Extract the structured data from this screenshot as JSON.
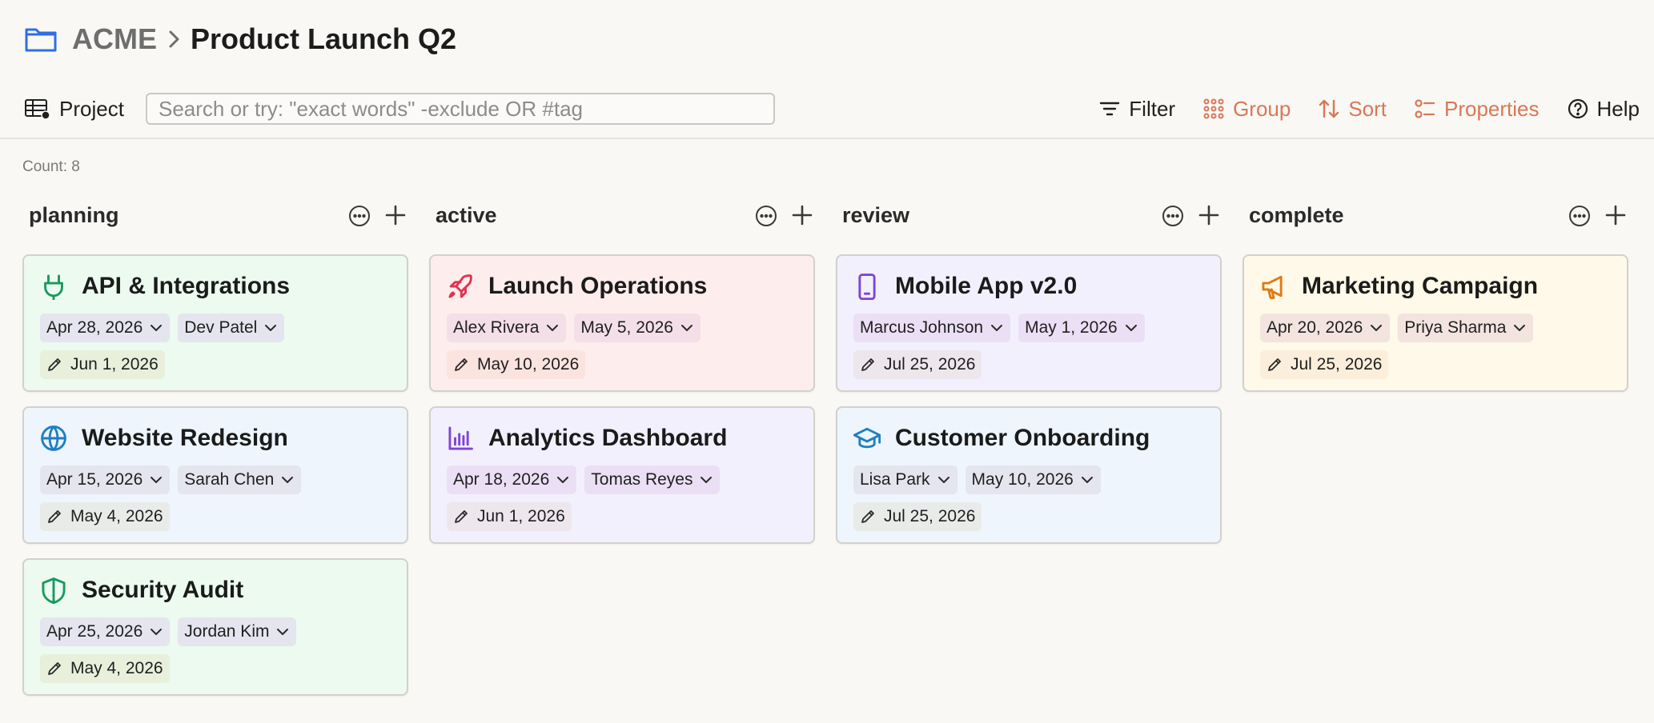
{
  "breadcrumb": {
    "root": "ACME",
    "current": "Product Launch Q2"
  },
  "toolbar": {
    "view_label": "Project",
    "search_placeholder": "Search or try: \"exact words\" -exclude OR #tag",
    "filter_label": "Filter",
    "group_label": "Group",
    "sort_label": "Sort",
    "properties_label": "Properties",
    "help_label": "Help"
  },
  "count_label": "Count: 8",
  "colors": {
    "accent": "#d97757",
    "folder_blue": "#2f6fe4"
  },
  "columns": [
    {
      "title": "planning",
      "cards": [
        {
          "title": "API & Integrations",
          "icon": "plug-icon",
          "icon_color": "#179a5b",
          "theme": "green",
          "chip1": "Apr 28, 2026",
          "chip2": "Dev Patel",
          "updated": "Jun 1, 2026"
        },
        {
          "title": "Website Redesign",
          "icon": "globe-icon",
          "icon_color": "#1f7fc2",
          "theme": "blue",
          "chip1": "Apr 15, 2026",
          "chip2": "Sarah Chen",
          "updated": "May 4, 2026"
        },
        {
          "title": "Security Audit",
          "icon": "shield-icon",
          "icon_color": "#179a5b",
          "theme": "green",
          "chip1": "Apr 25, 2026",
          "chip2": "Jordan Kim",
          "updated": "May 4, 2026"
        }
      ]
    },
    {
      "title": "active",
      "cards": [
        {
          "title": "Launch Operations",
          "icon": "rocket-icon",
          "icon_color": "#e0334f",
          "theme": "pink",
          "chip1": "Alex Rivera",
          "chip2": "May 5, 2026",
          "updated": "May 10, 2026"
        },
        {
          "title": "Analytics Dashboard",
          "icon": "bar-chart-icon",
          "icon_color": "#7c44d8",
          "theme": "lavender",
          "chip1": "Apr 18, 2026",
          "chip2": "Tomas Reyes",
          "updated": "Jun 1, 2026"
        }
      ]
    },
    {
      "title": "review",
      "cards": [
        {
          "title": "Mobile App v2.0",
          "icon": "phone-icon",
          "icon_color": "#7c44d8",
          "theme": "lavender",
          "chip1": "Marcus Johnson",
          "chip2": "May 1, 2026",
          "updated": "Jul 25, 2026"
        },
        {
          "title": "Customer Onboarding",
          "icon": "graduation-cap-icon",
          "icon_color": "#1f7fc2",
          "theme": "blue",
          "chip1": "Lisa Park",
          "chip2": "May 10, 2026",
          "updated": "Jul 25, 2026"
        }
      ]
    },
    {
      "title": "complete",
      "cards": [
        {
          "title": "Marketing Campaign",
          "icon": "megaphone-icon",
          "icon_color": "#e07a12",
          "theme": "cream",
          "chip1": "Apr 20, 2026",
          "chip2": "Priya Sharma",
          "updated": "Jul 25, 2026"
        }
      ]
    }
  ]
}
